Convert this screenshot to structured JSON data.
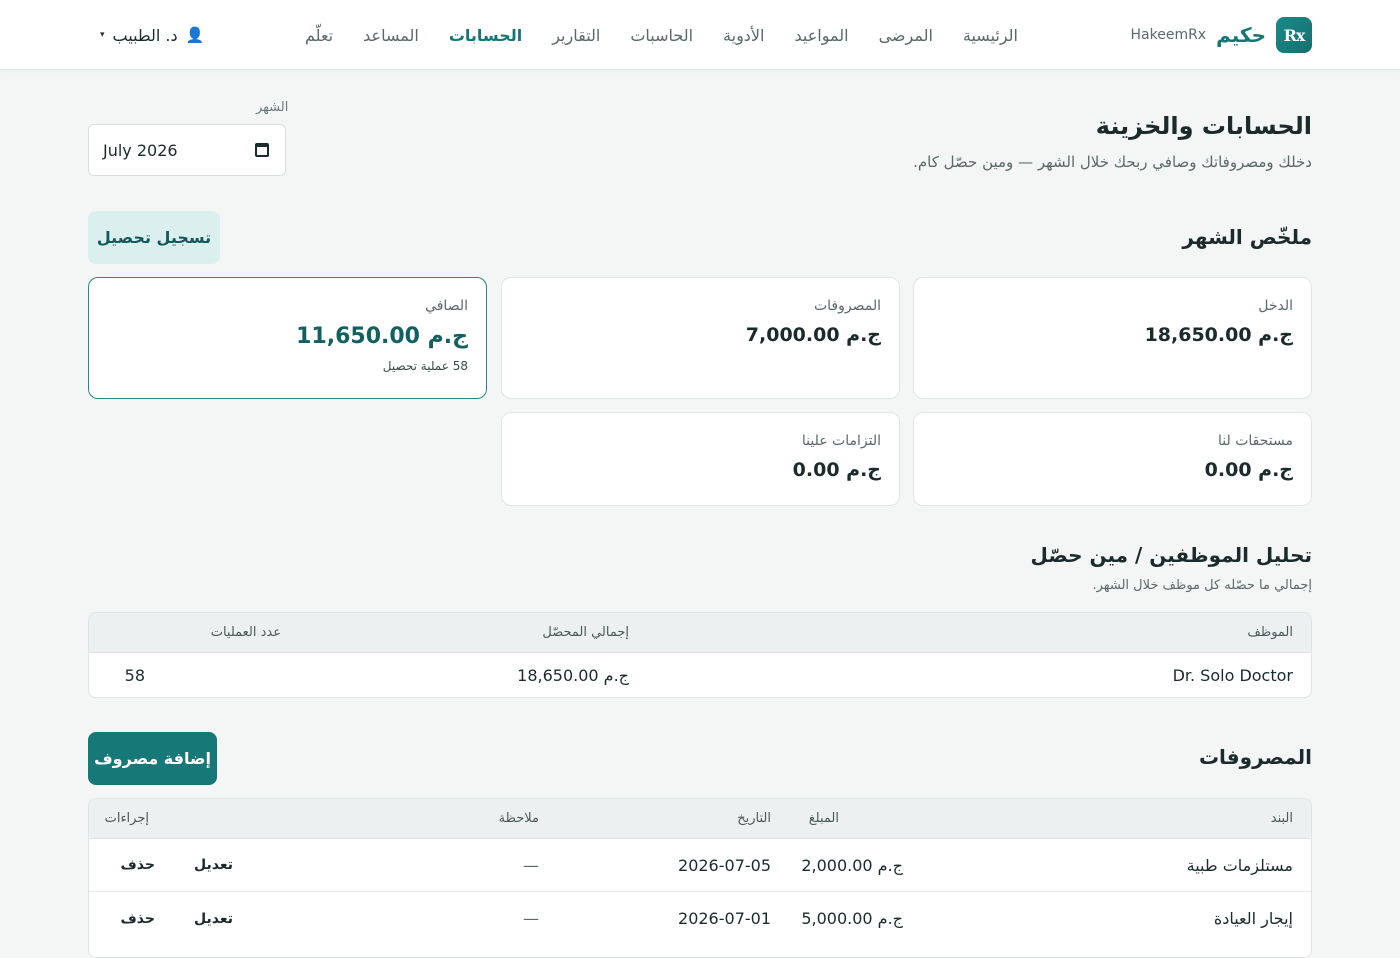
{
  "brand": {
    "logo_text": "Rx",
    "name_ar": "حكيم",
    "name_en": "HakeemRx"
  },
  "nav": {
    "items": [
      {
        "label": "الرئيسية",
        "active": false
      },
      {
        "label": "المرضى",
        "active": false
      },
      {
        "label": "المواعيد",
        "active": false
      },
      {
        "label": "الأدوية",
        "active": false
      },
      {
        "label": "الحاسبات",
        "active": false
      },
      {
        "label": "التقارير",
        "active": false
      },
      {
        "label": "الحسابات",
        "active": true
      },
      {
        "label": "المساعد",
        "active": false
      },
      {
        "label": "تعلّم",
        "active": false
      }
    ]
  },
  "user": {
    "name": "د. الطبيب",
    "caret": "▾",
    "icon": "user-icon"
  },
  "page": {
    "title": "الحسابات والخزينة",
    "subtitle": "دخلك ومصروفاتك وصافي ربحك خلال الشهر — ومين حصّل كام.",
    "month_label": "الشهر",
    "month_value": "July 2026"
  },
  "summary": {
    "title": "ملخّص الشهر",
    "record_button": "تسجيل تحصيل",
    "cards": {
      "income": {
        "label": "الدخل",
        "value": "ج.م 18,650.00"
      },
      "expenses": {
        "label": "المصروفات",
        "value": "ج.م 7,000.00"
      },
      "net": {
        "label": "الصافي",
        "value": "ج.م 11,650.00",
        "note": "58 عملية تحصيل"
      },
      "receivables": {
        "label": "مستحقات لنا",
        "value": "ج.م 0.00"
      },
      "payables": {
        "label": "التزامات علينا",
        "value": "ج.م 0.00"
      }
    }
  },
  "staff": {
    "title": "تحليل الموظفين / مين حصّل",
    "desc": "إجمالي ما حصّله كل موظف خلال الشهر.",
    "headers": {
      "employee": "الموظف",
      "total": "إجمالي المحصّل",
      "count": "عدد العمليات"
    },
    "rows": [
      {
        "employee": "Dr. Solo Doctor",
        "total": "ج.م 18,650.00",
        "count": "58"
      }
    ]
  },
  "expenses": {
    "title": "المصروفات",
    "add_button": "إضافة مصروف",
    "headers": {
      "item": "البند",
      "amount": "المبلغ",
      "date": "التاريخ",
      "note": "ملاحظة",
      "actions": "إجراءات"
    },
    "edit_label": "تعديل",
    "delete_label": "حذف",
    "rows": [
      {
        "item": "مستلزمات طبية",
        "amount": "ج.م 2,000.00",
        "date": "2026-07-05",
        "note": "—"
      },
      {
        "item": "إيجار العيادة",
        "amount": "ج.م 5,000.00",
        "date": "2026-07-01",
        "note": "—"
      }
    ]
  },
  "colors": {
    "accent": "#177878",
    "accent_light": "#dcefef",
    "background": "#f4f6f6"
  }
}
